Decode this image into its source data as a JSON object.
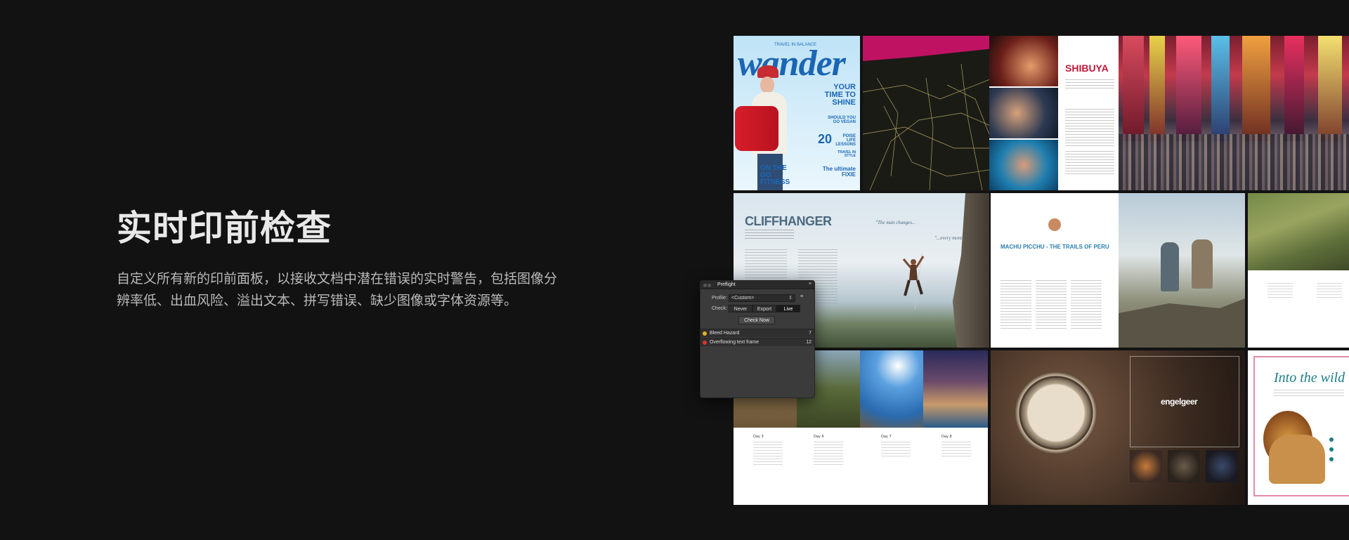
{
  "hero": {
    "title": "实时印前检查",
    "description": "自定义所有新的印前面板，以接收文档中潜在错误的实时警告，包括图像分辨率低、出血风险、溢出文本、拼写错误、缺少图像或字体资源等。"
  },
  "spreads": {
    "wander": {
      "tagline": "TRAVEL IN BALANCE",
      "logo": "wander",
      "headline1": "YOUR TIME TO SHINE",
      "headline2": "SHOULD YOU GO VEGAN",
      "headline3_num": "20",
      "headline3": "POISE LIFE LESSONS",
      "headline4": "TRAVEL IN STYLE",
      "headline5": "ON THE GO FITNESS",
      "headline6": "The ultimate FIXIE"
    },
    "shibuya": {
      "title": "SHIBUYA"
    },
    "cliffhanger": {
      "title": "CLIFFHANGER",
      "quote1": "\"The man changes...",
      "quote2": "\"...every month\""
    },
    "machu": {
      "title": "MACHU PICCHU - THE TRAILS OF PERU"
    },
    "travel": {
      "days": [
        "Day 3",
        "Day 6",
        "Day 7",
        "Day 8"
      ]
    },
    "watch": {
      "brand": "engelgeer"
    },
    "lion": {
      "title": "Into the wild"
    }
  },
  "preflight": {
    "title": "Preflight",
    "profile_label": "Profile:",
    "profile_value": "<Custom>",
    "check_label": "Check:",
    "check_options": [
      "Never",
      "Export",
      "Live"
    ],
    "check_selected": "Live",
    "check_now": "Check Now",
    "issues": [
      {
        "name": "Bleed Hazard",
        "count": "7",
        "color": "#e3b21b"
      },
      {
        "name": "Overflowing text frame",
        "count": "12",
        "color": "#d9342b"
      }
    ]
  }
}
